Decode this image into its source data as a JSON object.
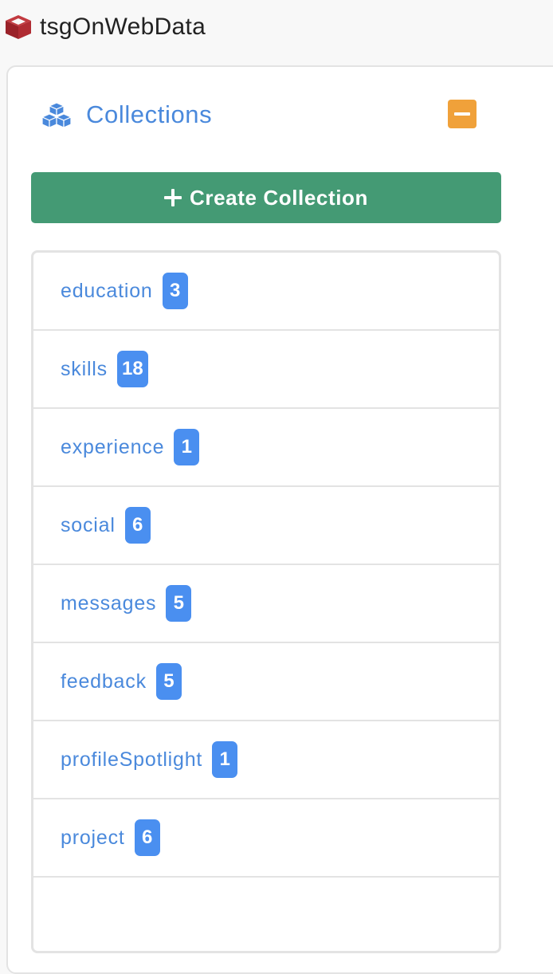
{
  "header": {
    "app_title": "tsgOnWebData",
    "app_icon": "cube-icon"
  },
  "panel": {
    "title": "Collections",
    "title_icon": "cubes-icon",
    "collapse_icon": "minus-icon",
    "create_button_label": "Create Collection",
    "create_button_icon": "plus-icon"
  },
  "collections": [
    {
      "name": "education",
      "count": "3"
    },
    {
      "name": "skills",
      "count": "18"
    },
    {
      "name": "experience",
      "count": "1"
    },
    {
      "name": "social",
      "count": "6"
    },
    {
      "name": "messages",
      "count": "5"
    },
    {
      "name": "feedback",
      "count": "5"
    },
    {
      "name": "profileSpotlight",
      "count": "1"
    },
    {
      "name": "project",
      "count": "6"
    }
  ],
  "colors": {
    "accent_blue": "#4a89dc",
    "badge_blue": "#4a8ff0",
    "create_green": "#449a74",
    "collapse_orange": "#f0a13a",
    "app_icon_red": "#a32830"
  }
}
